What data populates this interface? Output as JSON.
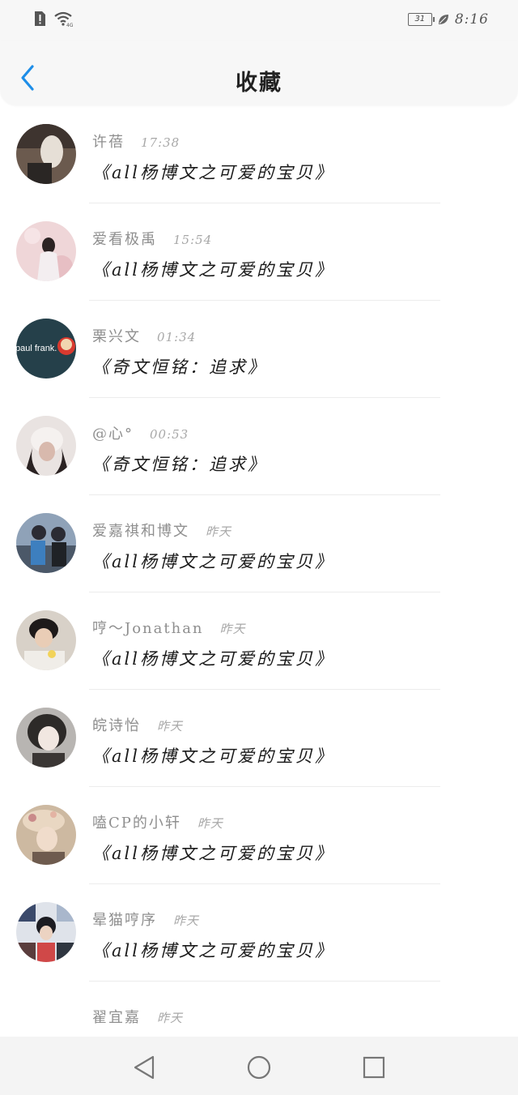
{
  "status_bar": {
    "time": "8:16",
    "battery": "31",
    "icons": [
      "alert-icon",
      "wifi-icon",
      "battery-icon",
      "leaf-icon"
    ]
  },
  "header": {
    "title": "收藏",
    "back_icon": "chevron-left-icon",
    "accent_color": "#1e8ee8"
  },
  "favorites": [
    {
      "name": "许蓓",
      "time": "17:38",
      "content": "《all杨博文之可爱的宝贝》",
      "avatar_color": "#6b5a4e"
    },
    {
      "name": "爱看极禹",
      "time": "15:54",
      "content": "《all杨博文之可爱的宝贝》",
      "avatar_color": "#e8c9c9"
    },
    {
      "name": "栗兴文",
      "time": "01:34",
      "content": "《奇文恒铭：追求》",
      "avatar_color": "#25404a"
    },
    {
      "name": "@心°",
      "time": "00:53",
      "content": "《奇文恒铭：追求》",
      "avatar_color": "#d9cfcc"
    },
    {
      "name": "爱嘉祺和博文",
      "time": "昨天",
      "content": "《all杨博文之可爱的宝贝》",
      "avatar_color": "#5f6f85"
    },
    {
      "name": "哼～Jonathan",
      "time": "昨天",
      "content": "《all杨博文之可爱的宝贝》",
      "avatar_color": "#3a3530"
    },
    {
      "name": "皖诗怡",
      "time": "昨天",
      "content": "《all杨博文之可爱的宝贝》",
      "avatar_color": "#8a8683"
    },
    {
      "name": "嗑CP的小轩",
      "time": "昨天",
      "content": "《all杨博文之可爱的宝贝》",
      "avatar_color": "#cdb9a1"
    },
    {
      "name": "晕猫哼序",
      "time": "昨天",
      "content": "《all杨博文之可爱的宝贝》",
      "avatar_color": "#4a4f66"
    },
    {
      "name": "翟宜嘉",
      "time": "昨天",
      "content": "",
      "avatar_color": "#ffffff"
    }
  ],
  "nav_bar": {
    "icons": [
      "back-triangle-icon",
      "home-circle-icon",
      "recents-square-icon"
    ]
  }
}
